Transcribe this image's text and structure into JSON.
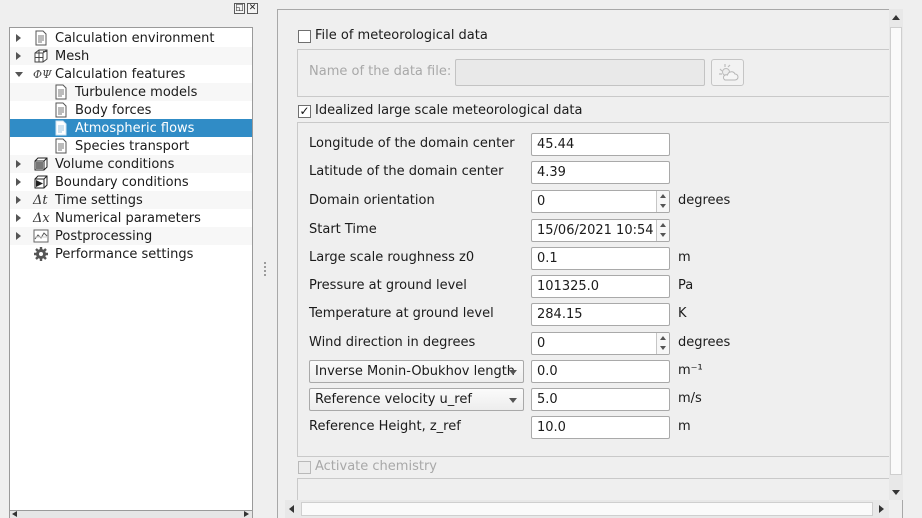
{
  "dock": {
    "float_glyph": "◱",
    "close_glyph": "✕"
  },
  "tree": {
    "items": [
      {
        "label": "Calculation environment",
        "icon": "document-icon",
        "expander": "collapsed",
        "level": 0
      },
      {
        "label": "Mesh",
        "icon": "mesh-icon",
        "expander": "collapsed",
        "level": 0
      },
      {
        "label": "Calculation features",
        "icon": "phi-psi-icon",
        "expander": "expanded",
        "level": 0
      },
      {
        "label": "Turbulence models",
        "icon": "document-icon",
        "expander": "none",
        "level": 1
      },
      {
        "label": "Body forces",
        "icon": "document-icon",
        "expander": "none",
        "level": 1
      },
      {
        "label": "Atmospheric flows",
        "icon": "document-icon",
        "expander": "none",
        "level": 1,
        "selected": true
      },
      {
        "label": "Species transport",
        "icon": "document-icon",
        "expander": "none",
        "level": 1
      },
      {
        "label": "Volume conditions",
        "icon": "cube-icon",
        "expander": "collapsed",
        "level": 0
      },
      {
        "label": "Boundary conditions",
        "icon": "boundary-icon",
        "expander": "collapsed",
        "level": 0
      },
      {
        "label": "Time settings",
        "icon": "delta-t-icon",
        "expander": "collapsed",
        "level": 0
      },
      {
        "label": "Numerical parameters",
        "icon": "delta-x-icon",
        "expander": "collapsed",
        "level": 0
      },
      {
        "label": "Postprocessing",
        "icon": "chart-icon",
        "expander": "collapsed",
        "level": 0
      },
      {
        "label": "Performance settings",
        "icon": "gear-icon",
        "expander": "none",
        "level": 0
      }
    ],
    "symbols": {
      "phi_psi": "ΦΨ",
      "delta_t": "Δt",
      "delta_x": "Δx"
    }
  },
  "meteo_file": {
    "checkbox_label": "File of meteorological data",
    "checked": false,
    "data_file_label": "Name of the data file:",
    "data_file_value": ""
  },
  "idealized": {
    "checkbox_label": "Idealized large scale meteorological data",
    "checked": true,
    "check_glyph": "✓",
    "rows": [
      {
        "label": "Longitude of the domain center",
        "value": "45.44",
        "unit": ""
      },
      {
        "label": "Latitude of the domain center",
        "value": "4.39",
        "unit": ""
      },
      {
        "label": "Domain orientation",
        "value": "0",
        "unit": "degrees"
      },
      {
        "label": "Start Time",
        "value": "15/06/2021 10:54",
        "unit": ""
      },
      {
        "label": "Large scale roughness z0",
        "value": "0.1",
        "unit": "m"
      },
      {
        "label": "Pressure at ground level",
        "value": "101325.0",
        "unit": "Pa"
      },
      {
        "label": "Temperature at ground level",
        "value": "284.15",
        "unit": "K"
      },
      {
        "label": "Wind direction in degrees",
        "value": "0",
        "unit": "degrees"
      },
      {
        "label": "Inverse Monin-Obukhov length",
        "value": "0.0",
        "unit": "m⁻¹"
      },
      {
        "label": "Reference velocity u_ref",
        "value": "5.0",
        "unit": "m/s"
      },
      {
        "label": "Reference Height, z_ref",
        "value": "10.0",
        "unit": "m"
      }
    ]
  },
  "chemistry": {
    "checkbox_label": "Activate chemistry",
    "checked": false,
    "enabled": false
  },
  "colors": {
    "selection": "#308cc6",
    "panel_bg": "#efefef"
  }
}
